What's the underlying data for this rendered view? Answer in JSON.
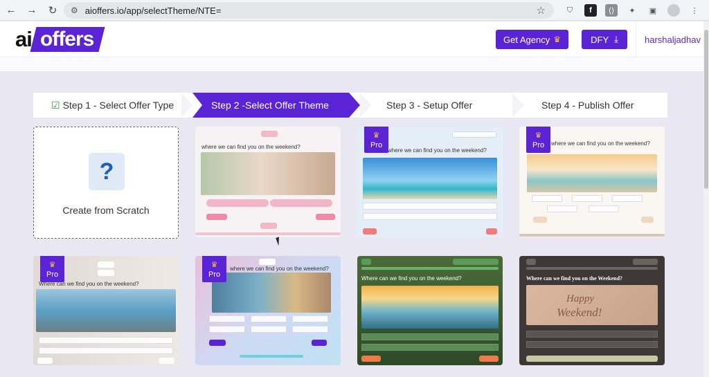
{
  "browser": {
    "url": "aioffers.io/app/selectTheme/NTE=",
    "nav_back": "←",
    "nav_forward": "→",
    "nav_reload": "↻"
  },
  "header": {
    "logo_ai": "ai",
    "logo_offers": "offers",
    "agency_label": "Get Agency",
    "dfy_label": "DFY",
    "username": "harshaljadhav"
  },
  "steps": [
    {
      "label": "Step 1 - Select Offer Type",
      "state": "done"
    },
    {
      "label": "Step 2 -Select Offer Theme",
      "state": "active"
    },
    {
      "label": "Step 3 - Setup Offer",
      "state": "pending"
    },
    {
      "label": "Step 4 - Publish Offer",
      "state": "pending"
    }
  ],
  "scratch": {
    "label": "Create from Scratch",
    "icon": "question-icon"
  },
  "themes": {
    "pro_label": "Pro",
    "question_lower": "where we can find you on the weekend?",
    "question_title": "Where can we find you on the weekend?",
    "question_caps": "Where can we find you on the Weekend?",
    "happy": "Happy",
    "weekend": "Weekend!"
  },
  "colors": {
    "brand": "#5b23d6",
    "crown": "#f2c33b",
    "check": "#2e9b4e"
  }
}
